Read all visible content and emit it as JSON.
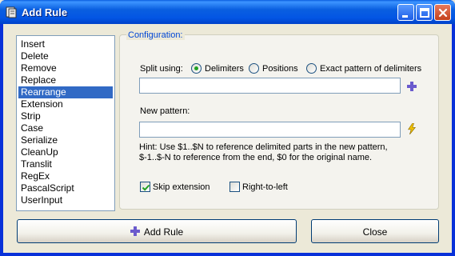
{
  "window": {
    "title": "Add Rule",
    "icon": "app-icon",
    "controls": [
      "minimize-icon",
      "maximize-icon",
      "close-icon"
    ]
  },
  "rules": {
    "items": [
      "Insert",
      "Delete",
      "Remove",
      "Replace",
      "Rearrange",
      "Extension",
      "Strip",
      "Case",
      "Serialize",
      "CleanUp",
      "Translit",
      "RegEx",
      "PascalScript",
      "UserInput"
    ],
    "selected": "Rearrange"
  },
  "config": {
    "group_label": "Configuration:",
    "split_label": "Split using:",
    "split_options": [
      "Delimiters",
      "Positions",
      "Exact pattern of delimiters"
    ],
    "split_selected": "Delimiters",
    "split_value": "",
    "add_delimiter_icon": "plus-icon",
    "new_pattern_label": "New pattern:",
    "new_pattern_value": "",
    "insert_meta_icon": "lightning-icon",
    "hint_line1": "Hint: Use $1..$N to reference delimited parts in the new pattern,",
    "hint_line2": "$-1..$-N to reference from the end, $0 for the original name.",
    "skip_extension_label": "Skip extension",
    "skip_extension_checked": true,
    "right_to_left_label": "Right-to-left",
    "right_to_left_checked": false
  },
  "buttons": {
    "add_rule": "Add Rule",
    "add_rule_icon": "plus-icon",
    "close": "Close"
  },
  "colors": {
    "titlebar": "#0a5fe0",
    "selection": "#316ac5",
    "group_label": "#0046d5",
    "plus_icon": "#6a5acd",
    "lightning_icon": "#f0c000"
  }
}
